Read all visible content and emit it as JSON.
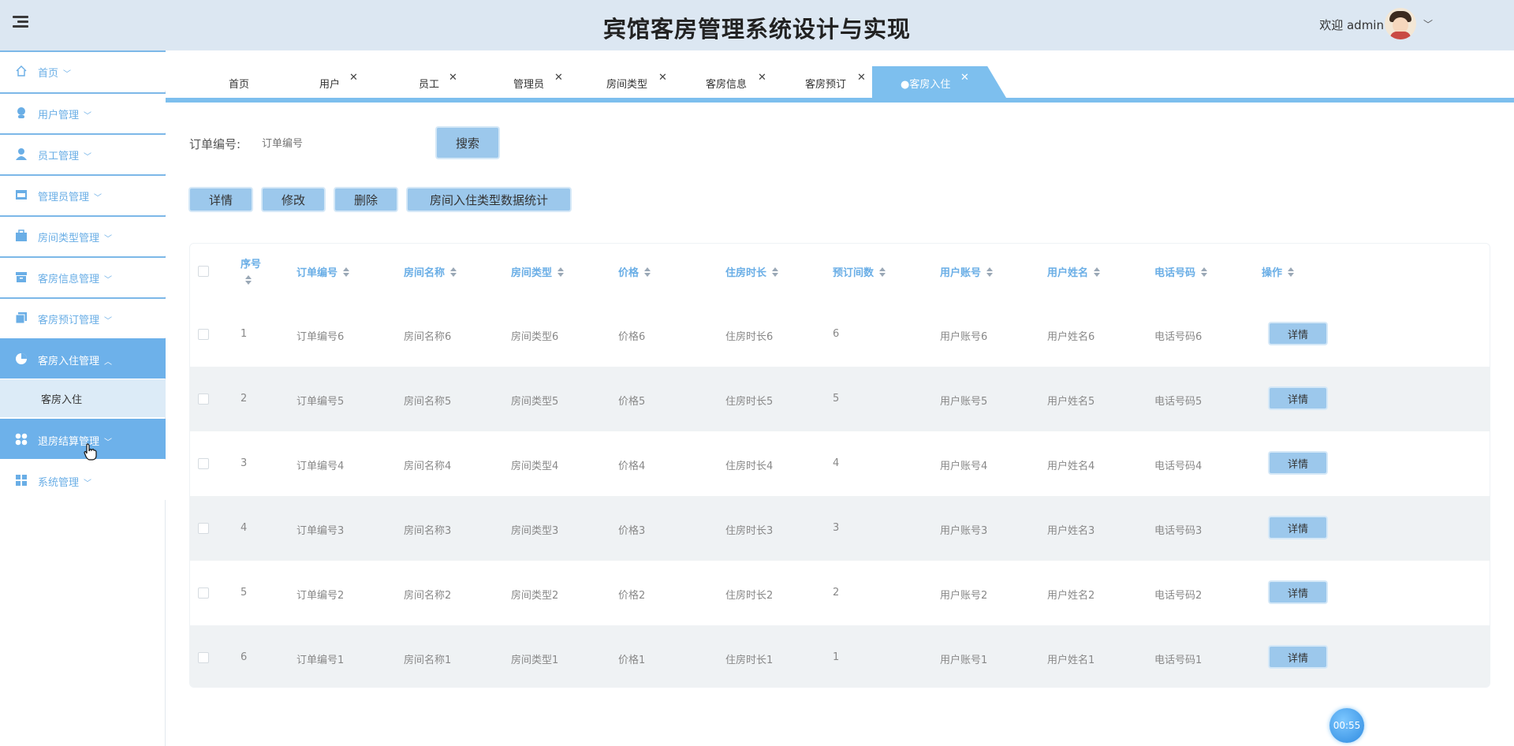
{
  "header": {
    "title": "宾馆客房管理系统设计与实现",
    "welcome": "欢迎 admin"
  },
  "sidebar": {
    "items": [
      {
        "label": "首页",
        "icon": "home-icon"
      },
      {
        "label": "用户管理",
        "icon": "user-icon"
      },
      {
        "label": "员工管理",
        "icon": "person-icon"
      },
      {
        "label": "管理员管理",
        "icon": "store-icon"
      },
      {
        "label": "房间类型管理",
        "icon": "briefcase-icon"
      },
      {
        "label": "客房信息管理",
        "icon": "archive-icon"
      },
      {
        "label": "客房预订管理",
        "icon": "copy-icon"
      },
      {
        "label": "客房入住管理",
        "icon": "pie-chart-icon"
      },
      {
        "label": "退房结算管理",
        "icon": "apps-icon"
      },
      {
        "label": "系统管理",
        "icon": "grid-icon"
      }
    ],
    "sub_item": "客房入住"
  },
  "tabs": [
    {
      "label": "首页"
    },
    {
      "label": "用户"
    },
    {
      "label": "员工"
    },
    {
      "label": "管理员"
    },
    {
      "label": "房间类型"
    },
    {
      "label": "客房信息"
    },
    {
      "label": "客房预订"
    },
    {
      "label": "●客房入住"
    }
  ],
  "search": {
    "label": "订单编号:",
    "placeholder": "订单编号",
    "button": "搜索"
  },
  "actions": {
    "detail": "详情",
    "edit": "修改",
    "delete": "删除",
    "stats": "房间入住类型数据统计"
  },
  "table": {
    "headers": [
      "序号",
      "订单编号",
      "房间名称",
      "房间类型",
      "价格",
      "住房时长",
      "预订间数",
      "用户账号",
      "用户姓名",
      "电话号码",
      "操作"
    ],
    "rows": [
      [
        "1",
        "订单编号6",
        "房间名称6",
        "房间类型6",
        "价格6",
        "住房时长6",
        "6",
        "用户账号6",
        "用户姓名6",
        "电话号码6"
      ],
      [
        "2",
        "订单编号5",
        "房间名称5",
        "房间类型5",
        "价格5",
        "住房时长5",
        "5",
        "用户账号5",
        "用户姓名5",
        "电话号码5"
      ],
      [
        "3",
        "订单编号4",
        "房间名称4",
        "房间类型4",
        "价格4",
        "住房时长4",
        "4",
        "用户账号4",
        "用户姓名4",
        "电话号码4"
      ],
      [
        "4",
        "订单编号3",
        "房间名称3",
        "房间类型3",
        "价格3",
        "住房时长3",
        "3",
        "用户账号3",
        "用户姓名3",
        "电话号码3"
      ],
      [
        "5",
        "订单编号2",
        "房间名称2",
        "房间类型2",
        "价格2",
        "住房时长2",
        "2",
        "用户账号2",
        "用户姓名2",
        "电话号码2"
      ],
      [
        "6",
        "订单编号1",
        "房间名称1",
        "房间类型1",
        "价格1",
        "住房时长1",
        "1",
        "用户账号1",
        "用户姓名1",
        "电话号码1"
      ]
    ],
    "row_button": "详情"
  },
  "timer": "00:55",
  "colors": {
    "header_bg": "#dce7f2",
    "accent": "#6db1ea",
    "button": "#9cc8ec"
  }
}
